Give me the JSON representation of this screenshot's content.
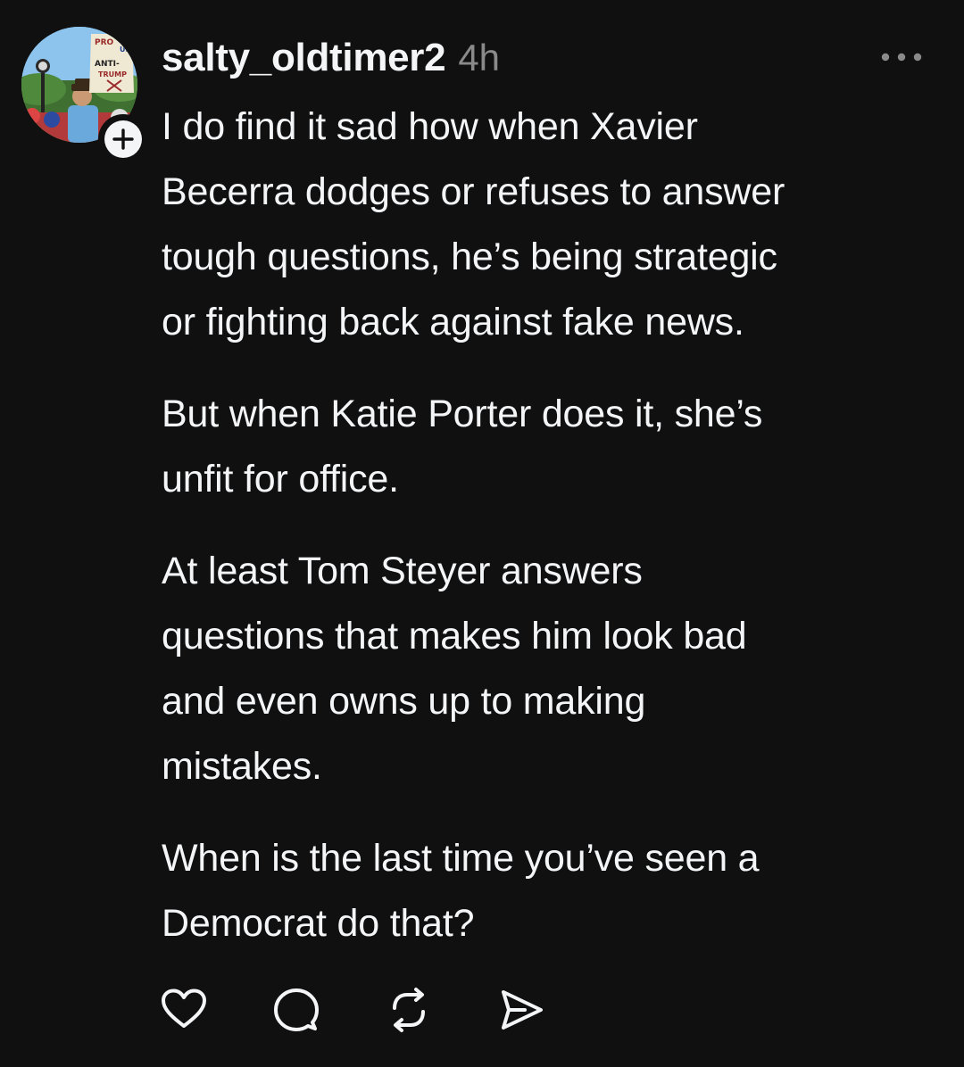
{
  "post": {
    "username": "salty_oldtimer2",
    "timestamp": "4h",
    "avatar": {
      "sign_text_lines": [
        "PRO",
        "US",
        "ANTI-",
        "TRUMP"
      ]
    },
    "follow_icon": "plus-icon",
    "more_icon": "more-horizontal-icon",
    "paragraphs": [
      "I do find it sad how when Xavier\nBecerra dodges or refuses to answer\ntough questions, he’s being strategic\nor fighting back against fake news.",
      "But when Katie Porter does it, she’s\nunfit for office.",
      "At least Tom Steyer answers\nquestions that makes him look bad\nand even owns up to making\nmistakes.",
      "When is the last time you’ve seen a\nDemocrat do that?"
    ],
    "actions": [
      {
        "name": "like",
        "icon": "heart-icon"
      },
      {
        "name": "reply",
        "icon": "comment-icon"
      },
      {
        "name": "repost",
        "icon": "repost-icon"
      },
      {
        "name": "share",
        "icon": "send-icon"
      }
    ]
  },
  "colors": {
    "background": "#101010",
    "text": "#f3f5f7",
    "muted": "#8a8a8a"
  }
}
